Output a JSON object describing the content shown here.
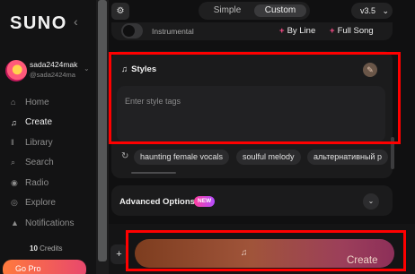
{
  "sidebar": {
    "logo": "SUNO",
    "collapse_icon": "‹",
    "user": {
      "name": "sada2424mak",
      "handle": "@sada2424ma"
    },
    "items": [
      {
        "label": "Home",
        "icon": "⌂"
      },
      {
        "label": "Create",
        "icon": "♫"
      },
      {
        "label": "Library",
        "icon": "‖"
      },
      {
        "label": "Search",
        "icon": "⌕"
      },
      {
        "label": "Radio",
        "icon": "◉"
      },
      {
        "label": "Explore",
        "icon": "◎"
      },
      {
        "label": "Notifications",
        "icon": "▲"
      }
    ],
    "credits_count": "10",
    "credits_label": "Credits",
    "upgrade_label": "Go Pro"
  },
  "topbar": {
    "settings_icon": "⚙",
    "mode_simple": "Simple",
    "mode_custom": "Custom",
    "version": "v3.5",
    "version_chevron": "⌄"
  },
  "instrumental": {
    "label": "Instrumental",
    "by_line": "By Line",
    "full_song": "Full Song"
  },
  "styles": {
    "title": "Styles",
    "input_value": "",
    "placeholder": "Enter style tags",
    "tags": [
      "haunting female vocals",
      "soulful melody",
      "альтернативный р"
    ]
  },
  "advanced": {
    "label": "Advanced Options",
    "badge": "NEW"
  },
  "bottom": {
    "plus": "+",
    "create_label": "Create"
  },
  "colors": {
    "highlight": "#ff0000",
    "accent_pink": "#ff4f8b"
  }
}
